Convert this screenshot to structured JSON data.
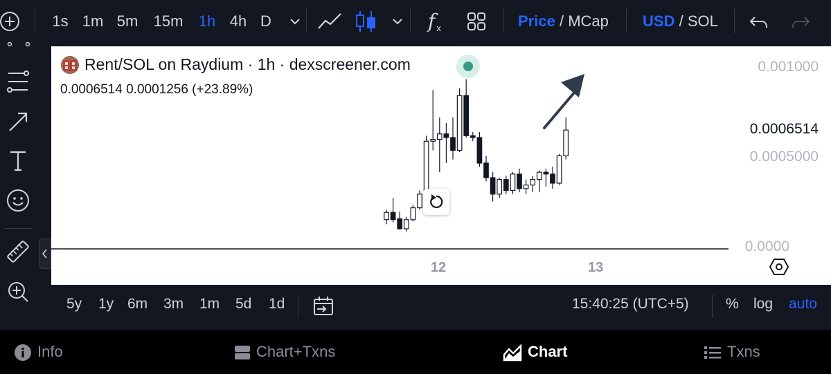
{
  "toolbar": {
    "intervals": [
      "1s",
      "1m",
      "5m",
      "15m",
      "1h",
      "4h",
      "D"
    ],
    "active_interval": "1h",
    "price_label": "Price",
    "mcap_label": "MCap",
    "usd_label": "USD",
    "sol_label": "SOL",
    "separator": "/"
  },
  "legend": {
    "title": "Rent/SOL on Raydium · 1h · dexscreener.com",
    "values": "0.0006514  0.0001256 (+23.89%)"
  },
  "price_axis": {
    "top": "0.001000",
    "current": "0.0006514",
    "mid": "0.0005000",
    "bottom": "0.0000"
  },
  "time_axis": [
    "12",
    "13"
  ],
  "range_bar": {
    "ranges": [
      "5y",
      "1y",
      "6m",
      "3m",
      "1m",
      "5d",
      "1d"
    ],
    "clock": "15:40:25 (UTC+5)",
    "percent_label": "%",
    "log_label": "log",
    "auto_label": "auto"
  },
  "footer": {
    "tabs": [
      "Info",
      "Chart+Txns",
      "Chart",
      "Txns"
    ],
    "active": "Chart"
  },
  "colors": {
    "accent": "#2962ff",
    "background": "#131722",
    "live_dot": "#3a9c85",
    "arrow": "#2f3b4a"
  },
  "chart_data": {
    "type": "candlestick",
    "interval": "1h",
    "ylim": [
      0.0,
      0.001
    ],
    "candles": [
      {
        "o": 0.00016,
        "h": 0.000215,
        "l": 0.000135,
        "c": 0.0002
      },
      {
        "o": 0.0002,
        "h": 0.00028,
        "l": 0.000145,
        "c": 0.00016
      },
      {
        "o": 0.000165,
        "h": 0.000205,
        "l": 0.000105,
        "c": 0.00011
      },
      {
        "o": 0.00011,
        "h": 0.000175,
        "l": 9.5e-05,
        "c": 0.00016
      },
      {
        "o": 0.00016,
        "h": 0.00024,
        "l": 0.00015,
        "c": 0.000225
      },
      {
        "o": 0.000225,
        "h": 0.00032,
        "l": 0.000215,
        "c": 0.0003
      },
      {
        "o": 0.0003,
        "h": 0.00062,
        "l": 0.00029,
        "c": 0.00059
      },
      {
        "o": 0.00059,
        "h": 0.00087,
        "l": 0.00054,
        "c": 0.0006
      },
      {
        "o": 0.0006,
        "h": 0.00072,
        "l": 0.00042,
        "c": 0.00063
      },
      {
        "o": 0.00063,
        "h": 0.00069,
        "l": 0.00047,
        "c": 0.00061
      },
      {
        "o": 0.00061,
        "h": 0.00072,
        "l": 0.00049,
        "c": 0.00054
      },
      {
        "o": 0.00054,
        "h": 0.00088,
        "l": 0.00053,
        "c": 0.00084
      },
      {
        "o": 0.00084,
        "h": 0.00093,
        "l": 0.00061,
        "c": 0.00062
      },
      {
        "o": 0.00062,
        "h": 0.00064,
        "l": 0.00059,
        "c": 0.00061
      },
      {
        "o": 0.00061,
        "h": 0.00064,
        "l": 0.00045,
        "c": 0.00047
      },
      {
        "o": 0.00047,
        "h": 0.00051,
        "l": 0.00037,
        "c": 0.00039
      },
      {
        "o": 0.00039,
        "h": 0.00042,
        "l": 0.00026,
        "c": 0.0003
      },
      {
        "o": 0.0003,
        "h": 0.00039,
        "l": 0.00028,
        "c": 0.00038
      },
      {
        "o": 0.00038,
        "h": 0.0004,
        "l": 0.0003,
        "c": 0.00032
      },
      {
        "o": 0.00032,
        "h": 0.00042,
        "l": 0.0003,
        "c": 0.00041
      },
      {
        "o": 0.00041,
        "h": 0.00044,
        "l": 0.00031,
        "c": 0.00033
      },
      {
        "o": 0.00033,
        "h": 0.00038,
        "l": 0.0003,
        "c": 0.00035
      },
      {
        "o": 0.00035,
        "h": 0.0004,
        "l": 0.00031,
        "c": 0.00038
      },
      {
        "o": 0.00038,
        "h": 0.00043,
        "l": 0.00031,
        "c": 0.00042
      },
      {
        "o": 0.00042,
        "h": 0.00044,
        "l": 0.00034,
        "c": 0.00041
      },
      {
        "o": 0.00041,
        "h": 0.00045,
        "l": 0.00033,
        "c": 0.00036
      },
      {
        "o": 0.00036,
        "h": 0.00052,
        "l": 0.00035,
        "c": 0.00051
      },
      {
        "o": 0.00051,
        "h": 0.00072,
        "l": 0.00049,
        "c": 0.000651
      }
    ]
  }
}
